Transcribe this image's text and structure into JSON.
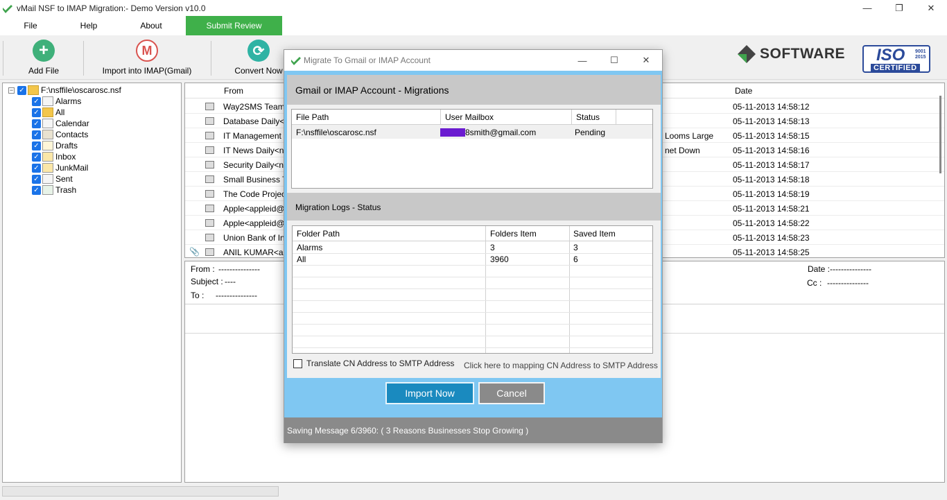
{
  "window": {
    "title": "vMail NSF to IMAP Migration:- Demo Version v10.0",
    "minimize": "—",
    "restore": "❐",
    "close": "✕"
  },
  "menu": {
    "file": "File",
    "help": "Help",
    "about": "About",
    "submit": "Submit Review"
  },
  "toolbar": {
    "add_file": "Add File",
    "import_imap": "Import into IMAP(Gmail)",
    "convert_now": "Convert Now",
    "brand_text": "SOFTWARE",
    "iso_text": "ISO",
    "iso_years": "9001\n2015",
    "iso_cert": "CERTIFIED"
  },
  "tree": {
    "root": "F:\\nsffile\\oscarosc.nsf",
    "items": [
      "Alarms",
      "All",
      "Calendar",
      "Contacts",
      "Drafts",
      "Inbox",
      "JunkMail",
      "Sent",
      "Trash"
    ]
  },
  "message_list": {
    "col_from": "From",
    "col_date": "Date",
    "rows": [
      {
        "from": "Way2SMS Team<",
        "subject": "",
        "date": "05-11-2013 14:58:12"
      },
      {
        "from": "Database Daily<ne",
        "subject": "",
        "date": "05-11-2013 14:58:13"
      },
      {
        "from": "IT Management Da",
        "subject": "Looms Large",
        "date": "05-11-2013 14:58:15"
      },
      {
        "from": "IT News Daily<new",
        "subject": "net Down",
        "date": "05-11-2013 14:58:16"
      },
      {
        "from": "Security Daily<new",
        "subject": "",
        "date": "05-11-2013 14:58:17"
      },
      {
        "from": "Small Business Tec",
        "subject": "",
        "date": "05-11-2013 14:58:18"
      },
      {
        "from": "The Code Project<",
        "subject": "",
        "date": "05-11-2013 14:58:19"
      },
      {
        "from": "Apple<appleid@id.",
        "subject": "",
        "date": "05-11-2013 14:58:21"
      },
      {
        "from": "Apple<appleid@id.",
        "subject": "",
        "date": "05-11-2013 14:58:22"
      },
      {
        "from": "Union Bank of Indi",
        "subject": "",
        "date": "05-11-2013 14:58:23"
      },
      {
        "from": "ANIL KUMAR<anil",
        "subject": "",
        "date": "05-11-2013 14:58:25"
      }
    ]
  },
  "preview": {
    "from_label": "From :",
    "from_value": "---------------",
    "subject_label": "Subject :",
    "subject_value": "----",
    "to_label": "To :",
    "to_value": "---------------",
    "date_label": "Date :",
    "date_value": "---------------",
    "cc_label": "Cc :",
    "cc_value": "---------------"
  },
  "dialog": {
    "title": "Migrate To Gmail or IMAP Account",
    "minimize": "—",
    "maximize": "☐",
    "close": "✕",
    "section1": "Gmail or IMAP Account - Migrations",
    "grid1": {
      "col_path": "File Path",
      "col_mailbox": "User Mailbox",
      "col_status": "Status",
      "row": {
        "path": "F:\\nsffile\\oscarosc.nsf",
        "mailbox": "8smith@gmail.com",
        "status": "Pending"
      }
    },
    "section2": "Migration Logs - Status",
    "grid2": {
      "col_folder": "Folder Path",
      "col_items": "Folders Item",
      "col_saved": "Saved Item",
      "rows": [
        {
          "folder": "Alarms",
          "items": "3",
          "saved": "3"
        },
        {
          "folder": "All",
          "items": "3960",
          "saved": "6"
        }
      ]
    },
    "translate_label": "Translate CN Address to SMTP Address",
    "mapping_link": "Click here to mapping CN Address to SMTP Address",
    "import_button": "Import Now",
    "cancel_button": "Cancel",
    "status": "Saving Message 6/3960: ( 3 Reasons Businesses Stop Growing )"
  }
}
